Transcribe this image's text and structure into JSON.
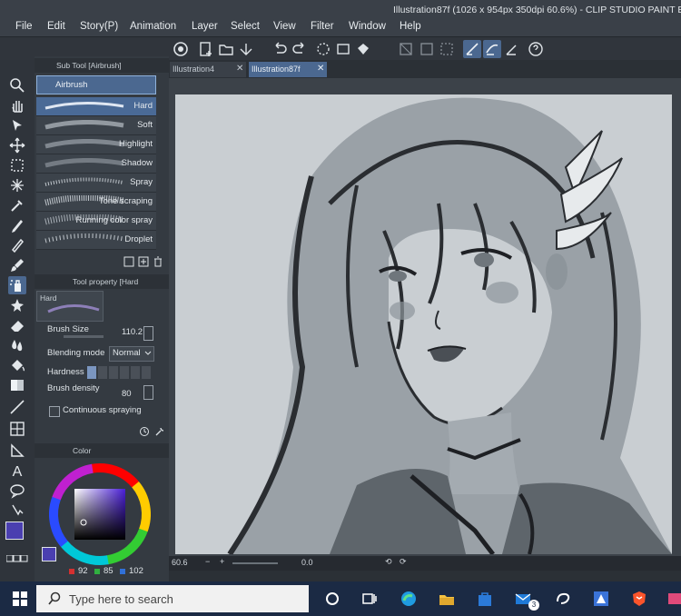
{
  "window": {
    "title": "Illustration87f (1026 x 954px 350dpi 60.6%) - CLIP STUDIO PAINT EX"
  },
  "menu": [
    "File",
    "Edit",
    "Story(P)",
    "Animation",
    "Layer",
    "Select",
    "View",
    "Filter",
    "Window",
    "Help"
  ],
  "tabs": [
    {
      "label": "Illustration4",
      "active": false
    },
    {
      "label": "Illustration87f",
      "active": true
    }
  ],
  "subtool": {
    "header": "Sub Tool [Airbrush]",
    "group": "Airbrush",
    "brushes": [
      "Hard",
      "Soft",
      "Highlight",
      "Shadow",
      "Spray",
      "Tone scraping",
      "Running color spray",
      "Droplet"
    ],
    "selected": "Hard"
  },
  "toolproperty": {
    "header": "Tool property [Hard",
    "preview_label": "Hard",
    "brush_size": {
      "label": "Brush Size",
      "value": "110.2"
    },
    "blending_mode": {
      "label": "Blending mode",
      "value": "Normal"
    },
    "hardness": {
      "label": "Hardness"
    },
    "brush_density": {
      "label": "Brush density",
      "value": "80"
    },
    "continuous_spraying": {
      "label": "Continuous spraying",
      "checked": false
    }
  },
  "color": {
    "header": "Color",
    "r": "92",
    "g": "85",
    "b": "102",
    "main": "#4a3fb0",
    "sub": "#ffffff"
  },
  "status": {
    "zoom": "60.6",
    "angle": "0.0"
  },
  "taskbar": {
    "search_placeholder": "Type here to search",
    "mail_badge": "3"
  },
  "colors": {
    "accent": "#4b6890",
    "panel": "#343a41",
    "taskbar": "#1b2a44"
  }
}
